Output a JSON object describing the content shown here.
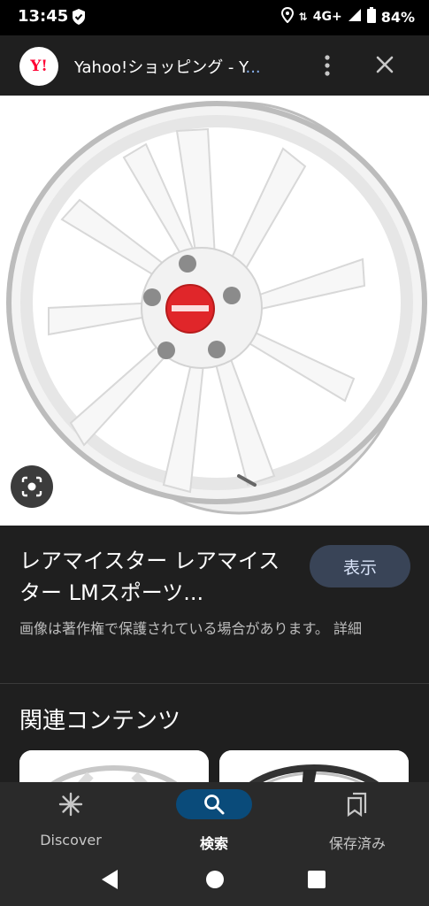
{
  "status_bar": {
    "time": "13:45",
    "network": "4G+",
    "battery": "84%"
  },
  "browser": {
    "favicon_text": "Y!",
    "tab_title": "Yahoo!ショッピング - Y",
    "tab_title_ellipsis": "..."
  },
  "info": {
    "title": "レアマイスター レアマイスター LMスポーツ...",
    "show_button": "表示",
    "copyright": "画像は著作権で保護されている場合があります。 詳細"
  },
  "related": {
    "heading": "関連コンテンツ"
  },
  "bottom_nav": {
    "items": [
      {
        "label": "Discover"
      },
      {
        "label": "検索"
      },
      {
        "label": "保存済み"
      }
    ]
  },
  "icons": [
    "shield-icon",
    "location-icon",
    "signal-icon",
    "battery-icon",
    "more-vert-icon",
    "close-icon",
    "lens-icon",
    "discover-icon",
    "search-icon",
    "bookmarks-icon",
    "back-icon",
    "home-icon",
    "recents-icon"
  ],
  "colors": {
    "accent": "#0a4b7a",
    "show_button_bg": "#394457",
    "favicon_red": "#ff0033"
  }
}
